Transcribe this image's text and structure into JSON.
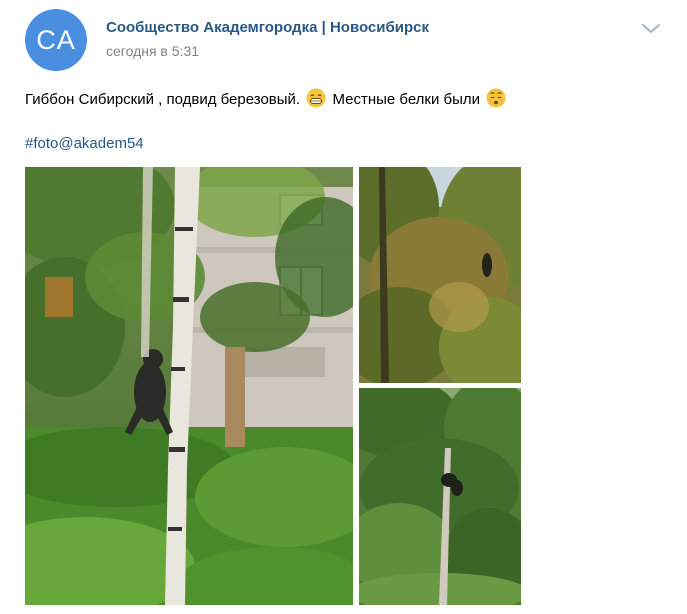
{
  "post": {
    "author_initials": "CA",
    "author_name": "Сообщество Академгородка | Новосибирск",
    "timestamp": "сегодня в 5:31",
    "text_part1": "Гиббон Сибирский , подвид березовый.",
    "text_part2": "Местные белки были",
    "emoji_1": "grinning-face-icon",
    "emoji_2": "hushed-face-icon",
    "hashtag": "#foto@akadem54",
    "accent_color": "#2a5885",
    "avatar_color": "#4a8fdf"
  },
  "photos": [
    {
      "name": "photo-gibbon-birch",
      "description_icon": "photo-icon"
    },
    {
      "name": "photo-treetops",
      "description_icon": "photo-icon"
    },
    {
      "name": "photo-tree-bottom",
      "description_icon": "photo-icon"
    }
  ]
}
